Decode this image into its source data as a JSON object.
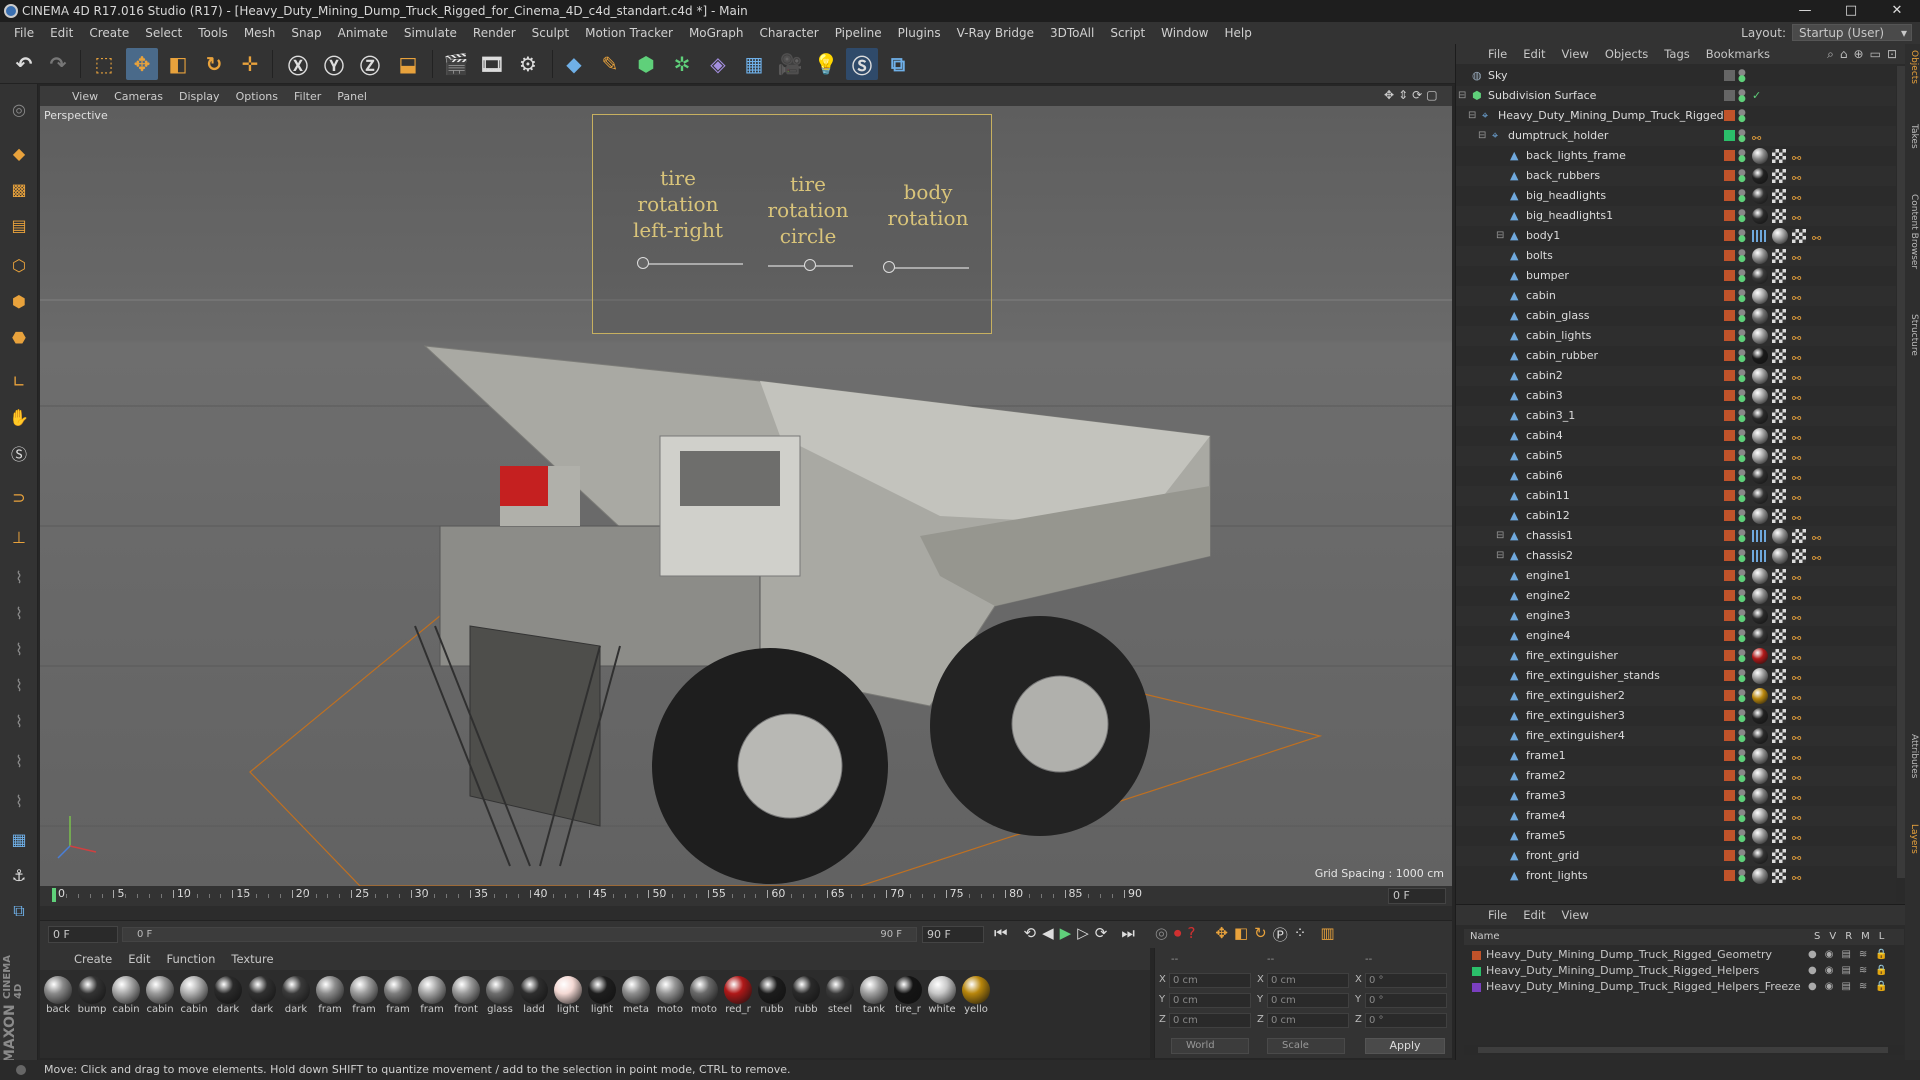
{
  "titlebar": {
    "title": "CINEMA 4D R17.016 Studio (R17) - [Heavy_Duty_Mining_Dump_Truck_Rigged_for_Cinema_4D_c4d_standart.c4d *] - Main",
    "minimize": "—",
    "maximize": "□",
    "close": "✕"
  },
  "menu": [
    "File",
    "Edit",
    "Create",
    "Select",
    "Tools",
    "Mesh",
    "Snap",
    "Animate",
    "Simulate",
    "Render",
    "Sculpt",
    "Motion Tracker",
    "MoGraph",
    "Character",
    "Pipeline",
    "Plugins",
    "V-Ray Bridge",
    "3DToAll",
    "Script",
    "Window",
    "Help"
  ],
  "layout": {
    "label": "Layout:",
    "value": "Startup (User)"
  },
  "viewport": {
    "menu": [
      "View",
      "Cameras",
      "Display",
      "Options",
      "Filter",
      "Panel"
    ],
    "camera_label": "Perspective",
    "grid_spacing": "Grid Spacing : 1000 cm",
    "hud": {
      "label1": "tire rotation\nleft-right",
      "label2": "tire rotation\ncircle",
      "label3": "body\nrotation"
    }
  },
  "timeline": {
    "ticks": [
      "0",
      "5",
      "10",
      "15",
      "20",
      "25",
      "30",
      "35",
      "40",
      "45",
      "50",
      "55",
      "60",
      "65",
      "70",
      "75",
      "80",
      "85",
      "90"
    ],
    "current_frame": "0 F"
  },
  "playbar": {
    "start_field": "0 F",
    "range_start": "0 F",
    "range_end": "90 F",
    "end_field": "90 F"
  },
  "materials": {
    "menu": [
      "Create",
      "Edit",
      "Function",
      "Texture"
    ],
    "items": [
      {
        "label": "back",
        "color": "#8a8a8a"
      },
      {
        "label": "bump",
        "color": "#333333"
      },
      {
        "label": "cabin",
        "color": "#a8a8a8"
      },
      {
        "label": "cabin",
        "color": "#9a9a9a"
      },
      {
        "label": "cabin",
        "color": "#b0b0b0"
      },
      {
        "label": "dark",
        "color": "#2a2a2a"
      },
      {
        "label": "dark",
        "color": "#303030"
      },
      {
        "label": "dark",
        "color": "#3a3a3a"
      },
      {
        "label": "fram",
        "color": "#8c8c8c"
      },
      {
        "label": "fram",
        "color": "#9c9c9c"
      },
      {
        "label": "fram",
        "color": "#7e7e7e"
      },
      {
        "label": "fram",
        "color": "#a4a4a4"
      },
      {
        "label": "front",
        "color": "#999999"
      },
      {
        "label": "glass",
        "color": "#6e6e6e"
      },
      {
        "label": "ladd",
        "color": "#2e2e2e"
      },
      {
        "label": "light",
        "color": "#f4d9d4"
      },
      {
        "label": "light",
        "color": "#1e1e1e"
      },
      {
        "label": "meta",
        "color": "#8e8e8e"
      },
      {
        "label": "moto",
        "color": "#959595"
      },
      {
        "label": "moto",
        "color": "#6a6a6a"
      },
      {
        "label": "red_r",
        "color": "#b01818"
      },
      {
        "label": "rubb",
        "color": "#1c1c1c"
      },
      {
        "label": "rubb",
        "color": "#2a2a2a"
      },
      {
        "label": "steel",
        "color": "#3a3a3a"
      },
      {
        "label": "tank",
        "color": "#a0a0a0"
      },
      {
        "label": "tire_r",
        "color": "#141414"
      },
      {
        "label": "white",
        "color": "#c8c8c8"
      },
      {
        "label": "yello",
        "color": "#b8860b"
      }
    ]
  },
  "coords": {
    "rows": [
      {
        "axis": "X",
        "pos": "0 cm",
        "axis2": "X",
        "size": "0 cm",
        "axis3": "X",
        "rot": "0 °"
      },
      {
        "axis": "Y",
        "pos": "0 cm",
        "axis2": "Y",
        "size": "0 cm",
        "axis3": "Y",
        "rot": "0 °"
      },
      {
        "axis": "Z",
        "pos": "0 cm",
        "axis2": "Z",
        "size": "0 cm",
        "axis3": "Z",
        "rot": "0 °"
      }
    ],
    "mode1": "World",
    "mode2": "Scale",
    "apply": "Apply",
    "header1": "--",
    "header2": "--",
    "header3": "--"
  },
  "status": "Move: Click and drag to move elements. Hold down SHIFT to quantize movement / add to the selection in point mode, CTRL to remove.",
  "objects": {
    "menu": [
      "File",
      "Edit",
      "View",
      "Objects",
      "Tags",
      "Bookmarks"
    ],
    "rows": [
      {
        "name": "Sky",
        "indent": 0,
        "icon": "sky",
        "tag": ""
      },
      {
        "name": "Subdivision Surface",
        "indent": 0,
        "icon": "subd",
        "tag": "check"
      },
      {
        "name": "Heavy_Duty_Mining_Dump_Truck_Rigged",
        "indent": 1,
        "icon": "null",
        "tag": ""
      },
      {
        "name": "dumptruck_holder",
        "indent": 2,
        "icon": "null",
        "tag": "xp"
      },
      {
        "name": "back_lights_frame",
        "indent": 3,
        "icon": "poly",
        "tag": "mat",
        "m": "#8a8a8a"
      },
      {
        "name": "back_rubbers",
        "indent": 3,
        "icon": "poly",
        "tag": "mat",
        "m": "#222222"
      },
      {
        "name": "big_headlights",
        "indent": 3,
        "icon": "poly",
        "tag": "mat",
        "m": "#333333"
      },
      {
        "name": "big_headlights1",
        "indent": 3,
        "icon": "poly",
        "tag": "mat",
        "m": "#2a2a2a"
      },
      {
        "name": "body1",
        "indent": 3,
        "icon": "poly",
        "tag": "mat2",
        "m": "#a0a0a0"
      },
      {
        "name": "bolts",
        "indent": 3,
        "icon": "poly",
        "tag": "mat",
        "m": "#909090"
      },
      {
        "name": "bumper",
        "indent": 3,
        "icon": "poly",
        "tag": "mat",
        "m": "#3a3a3a"
      },
      {
        "name": "cabin",
        "indent": 3,
        "icon": "poly",
        "tag": "mat",
        "m": "#a8a8a8"
      },
      {
        "name": "cabin_glass",
        "indent": 3,
        "icon": "poly",
        "tag": "mat",
        "m": "#707070"
      },
      {
        "name": "cabin_lights",
        "indent": 3,
        "icon": "poly",
        "tag": "mat",
        "m": "#999999"
      },
      {
        "name": "cabin_rubber",
        "indent": 3,
        "icon": "poly",
        "tag": "mat",
        "m": "#1a1a1a"
      },
      {
        "name": "cabin2",
        "indent": 3,
        "icon": "poly",
        "tag": "mat",
        "m": "#9a9a9a"
      },
      {
        "name": "cabin3",
        "indent": 3,
        "icon": "poly",
        "tag": "mat",
        "m": "#a2a2a2"
      },
      {
        "name": "cabin3_1",
        "indent": 3,
        "icon": "poly",
        "tag": "mat",
        "m": "#2a2a2a"
      },
      {
        "name": "cabin4",
        "indent": 3,
        "icon": "poly",
        "tag": "mat",
        "m": "#9c9c9c"
      },
      {
        "name": "cabin5",
        "indent": 3,
        "icon": "poly",
        "tag": "mat",
        "m": "#a6a6a6"
      },
      {
        "name": "cabin6",
        "indent": 3,
        "icon": "poly",
        "tag": "mat",
        "m": "#2e2e2e"
      },
      {
        "name": "cabin11",
        "indent": 3,
        "icon": "poly",
        "tag": "mat",
        "m": "#333333"
      },
      {
        "name": "cabin12",
        "indent": 3,
        "icon": "poly",
        "tag": "mat",
        "m": "#8e8e8e"
      },
      {
        "name": "chassis1",
        "indent": 3,
        "icon": "poly",
        "tag": "mat2",
        "m": "#909090"
      },
      {
        "name": "chassis2",
        "indent": 3,
        "icon": "poly",
        "tag": "mat2",
        "m": "#888888"
      },
      {
        "name": "engine1",
        "indent": 3,
        "icon": "poly",
        "tag": "mat",
        "m": "#999999"
      },
      {
        "name": "engine2",
        "indent": 3,
        "icon": "poly",
        "tag": "mat",
        "m": "#8a8a8a"
      },
      {
        "name": "engine3",
        "indent": 3,
        "icon": "poly",
        "tag": "mat",
        "m": "#2a2a2a"
      },
      {
        "name": "engine4",
        "indent": 3,
        "icon": "poly",
        "tag": "mat",
        "m": "#333333"
      },
      {
        "name": "fire_extinguisher",
        "indent": 3,
        "icon": "poly",
        "tag": "mat",
        "m": "#b01818"
      },
      {
        "name": "fire_extinguisher_stands",
        "indent": 3,
        "icon": "poly",
        "tag": "mat",
        "m": "#999999"
      },
      {
        "name": "fire_extinguisher2",
        "indent": 3,
        "icon": "poly",
        "tag": "mat",
        "m": "#b8860b"
      },
      {
        "name": "fire_extinguisher3",
        "indent": 3,
        "icon": "poly",
        "tag": "mat",
        "m": "#222222"
      },
      {
        "name": "fire_extinguisher4",
        "indent": 3,
        "icon": "poly",
        "tag": "mat",
        "m": "#2a2a2a"
      },
      {
        "name": "frame1",
        "indent": 3,
        "icon": "poly",
        "tag": "mat",
        "m": "#8c8c8c"
      },
      {
        "name": "frame2",
        "indent": 3,
        "icon": "poly",
        "tag": "mat",
        "m": "#9c9c9c"
      },
      {
        "name": "frame3",
        "indent": 3,
        "icon": "poly",
        "tag": "mat",
        "m": "#7e7e7e"
      },
      {
        "name": "frame4",
        "indent": 3,
        "icon": "poly",
        "tag": "mat",
        "m": "#a4a4a4"
      },
      {
        "name": "frame5",
        "indent": 3,
        "icon": "poly",
        "tag": "mat",
        "m": "#959595"
      },
      {
        "name": "front_grid",
        "indent": 3,
        "icon": "poly",
        "tag": "mat",
        "m": "#333333"
      },
      {
        "name": "front_lights",
        "indent": 3,
        "icon": "poly",
        "tag": "mat",
        "m": "#8a8a8a"
      }
    ]
  },
  "layers": {
    "menu": [
      "File",
      "Edit",
      "View"
    ],
    "header": {
      "name": "Name",
      "cols": [
        "S",
        "V",
        "R",
        "M",
        "L"
      ]
    },
    "rows": [
      {
        "name": "Heavy_Duty_Mining_Dump_Truck_Rigged_Geometry",
        "color": "#c0532a"
      },
      {
        "name": "Heavy_Duty_Mining_Dump_Truck_Rigged_Helpers",
        "color": "#2bbf6a"
      },
      {
        "name": "Heavy_Duty_Mining_Dump_Truck_Rigged_Helpers_Freeze",
        "color": "#7a3fbf"
      }
    ]
  },
  "side_tabs": [
    "Objects",
    "Takes",
    "Content Browser",
    "Structure",
    "Attributes",
    "Layers"
  ],
  "logo": {
    "brand": "MAXON",
    "product": "CINEMA 4D"
  }
}
